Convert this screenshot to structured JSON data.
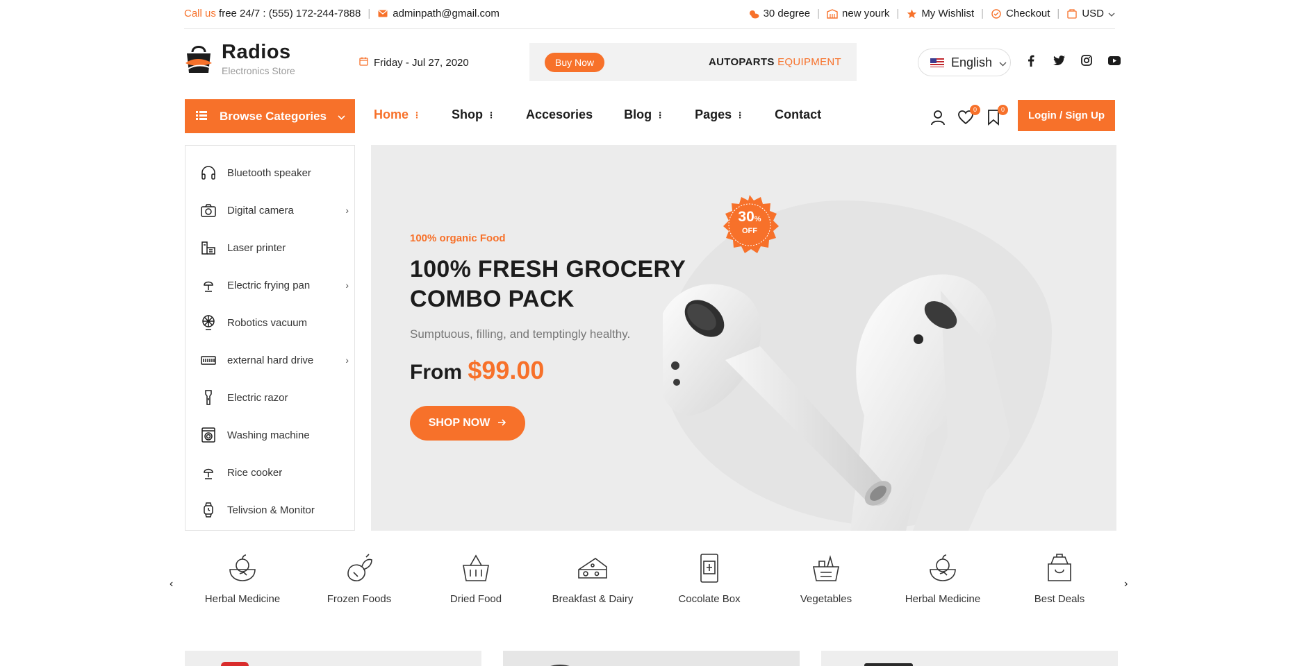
{
  "topbar": {
    "call_prefix": "Call us",
    "call_text": "free 24/7 : (555) 172-244-7888",
    "email": "adminpath@gmail.com",
    "weather": "30 degree",
    "city": "new yourk",
    "wishlist": "My Wishlist",
    "checkout": "Checkout",
    "currency": "USD"
  },
  "header": {
    "logo_title": "Radios",
    "logo_subtitle": "Electronics Store",
    "date": "Friday - Jul 27, 2020",
    "promo_button": "Buy Now",
    "promo_text_main": "AUTOPARTS",
    "promo_text_accent": "EQUIPMENT",
    "language": "English"
  },
  "nav": {
    "browse_label": "Browse Categories",
    "items": [
      {
        "label": "Home",
        "has_menu": true
      },
      {
        "label": "Shop",
        "has_menu": true
      },
      {
        "label": "Accesories",
        "has_menu": false
      },
      {
        "label": "Blog",
        "has_menu": true
      },
      {
        "label": "Pages",
        "has_menu": true
      },
      {
        "label": "Contact",
        "has_menu": false
      }
    ],
    "wishlist_count": "0",
    "saved_count": "0",
    "login_label": "Login / Sign Up"
  },
  "sidebar": {
    "items": [
      {
        "label": "Bluetooth speaker",
        "icon": "headphones-icon"
      },
      {
        "label": "Digital camera",
        "icon": "camera-icon",
        "submenu": true
      },
      {
        "label": "Laser printer",
        "icon": "printer-icon"
      },
      {
        "label": "Electric frying pan",
        "icon": "lamp-icon",
        "submenu": true
      },
      {
        "label": "Robotics vacuum",
        "icon": "fan-icon"
      },
      {
        "label": "external hard drive",
        "icon": "drive-icon",
        "submenu": true
      },
      {
        "label": "Electric razor",
        "icon": "flashlight-icon"
      },
      {
        "label": "Washing machine",
        "icon": "washing-machine-icon"
      },
      {
        "label": "Rice cooker",
        "icon": "lamp-icon"
      },
      {
        "label": "Telivsion & Monitor",
        "icon": "watch-icon"
      }
    ],
    "submenu_arrow": "›"
  },
  "hero": {
    "kicker": "100% organic Food",
    "title_line1": "100% FRESH GROCERY",
    "title_line2": "COMBO PACK",
    "subtitle": "Sumptuous, filling, and temptingly healthy.",
    "price_prefix": "From",
    "price": "$99.00",
    "button": "SHOP NOW",
    "badge_number": "30",
    "badge_percent": "%",
    "badge_off": "OFF"
  },
  "categories": {
    "items": [
      {
        "label": "Herbal Medicine",
        "icon": "fruit-bowl-icon"
      },
      {
        "label": "Frozen Foods",
        "icon": "vegetables-icon"
      },
      {
        "label": "Dried Food",
        "icon": "basket-icon"
      },
      {
        "label": "Breakfast & Dairy",
        "icon": "cheese-icon"
      },
      {
        "label": "Cocolate Box",
        "icon": "box-icon"
      },
      {
        "label": "Vegetables",
        "icon": "grocery-basket-icon"
      },
      {
        "label": "Herbal Medicine",
        "icon": "fruit-bowl-icon"
      },
      {
        "label": "Best Deals",
        "icon": "shopping-bag-icon"
      }
    ],
    "prev_arrow": "‹",
    "next_arrow": "›"
  },
  "colors": {
    "accent": "#f7712a",
    "text": "#1c1c1c",
    "muted": "#777777",
    "hero_bg": "#ececec"
  }
}
